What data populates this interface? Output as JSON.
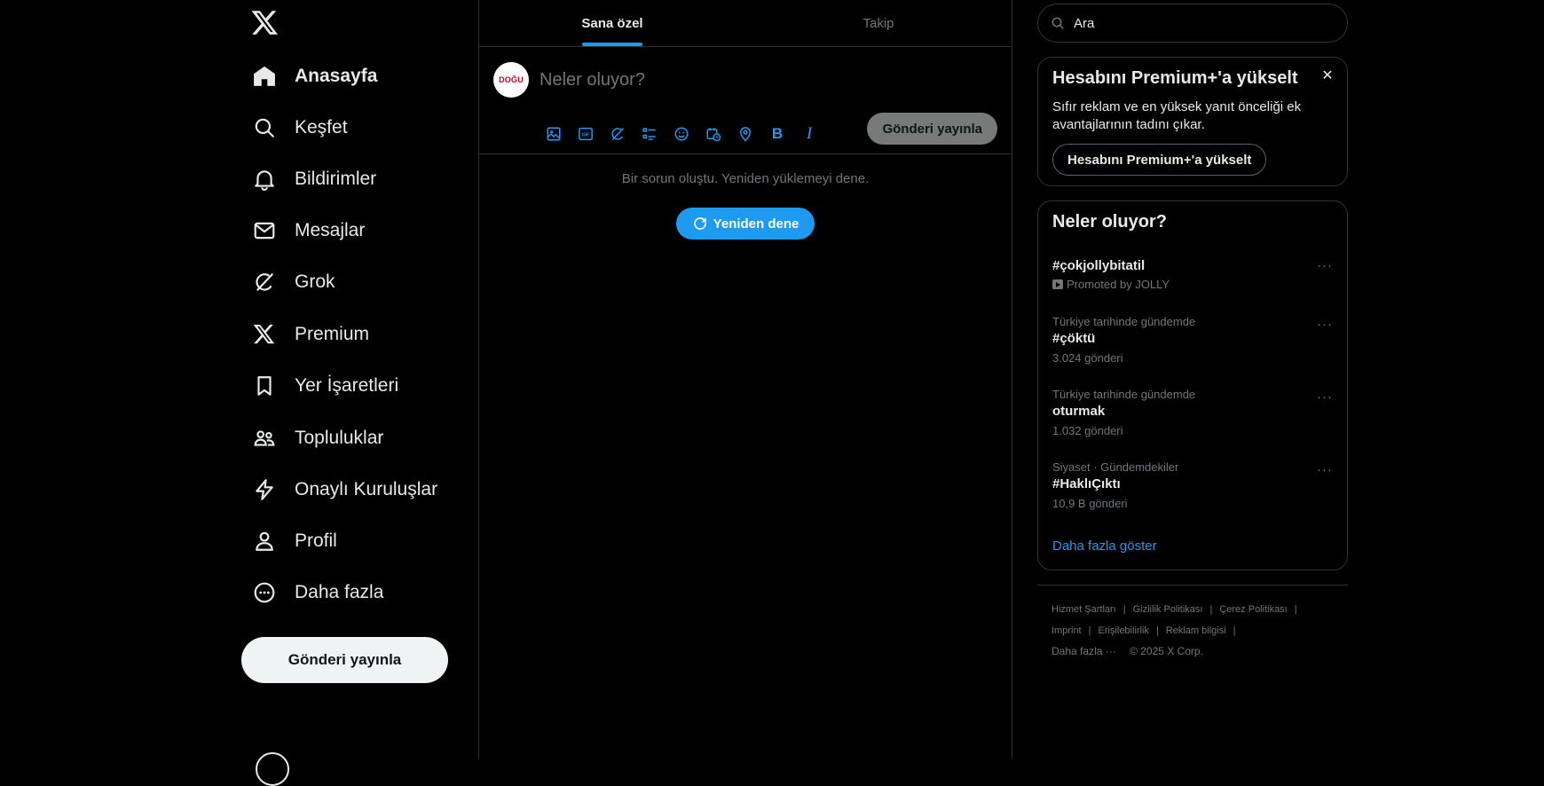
{
  "nav": {
    "items": [
      {
        "label": "Anasayfa",
        "icon": "home-icon",
        "active": true
      },
      {
        "label": "Keşfet",
        "icon": "search-icon"
      },
      {
        "label": "Bildirimler",
        "icon": "bell-icon"
      },
      {
        "label": "Mesajlar",
        "icon": "mail-icon"
      },
      {
        "label": "Grok",
        "icon": "grok-icon"
      },
      {
        "label": "Premium",
        "icon": "x-logo-icon"
      },
      {
        "label": "Yer İşaretleri",
        "icon": "bookmark-icon"
      },
      {
        "label": "Topluluklar",
        "icon": "communities-icon"
      },
      {
        "label": "Onaylı Kuruluşlar",
        "icon": "lightning-icon"
      },
      {
        "label": "Profil",
        "icon": "person-icon"
      },
      {
        "label": "Daha fazla",
        "icon": "more-circle-icon"
      }
    ],
    "post_button": "Gönderi yayınla"
  },
  "timeline": {
    "tabs": [
      {
        "label": "Sana özel",
        "active": true
      },
      {
        "label": "Takip",
        "active": false
      }
    ],
    "composer": {
      "avatar_text": "DOĞU",
      "placeholder": "Neler oluyor?",
      "tools": [
        "image-icon",
        "gif-icon",
        "grok-icon",
        "poll-icon",
        "emoji-icon",
        "schedule-icon",
        "location-icon",
        "bold-icon",
        "italic-icon"
      ],
      "bold_glyph": "B",
      "italic_glyph": "I",
      "submit": "Gönderi yayınla"
    },
    "error": "Bir sorun oluştu. Yeniden yüklemeyi dene.",
    "retry": "Yeniden dene"
  },
  "right": {
    "search_placeholder": "Ara",
    "premium": {
      "title": "Hesabını Premium+'a yükselt",
      "description": "Sıfır reklam ve en yüksek yanıt önceliği ek avantajlarının tadını çıkar.",
      "button": "Hesabını Premium+'a yükselt",
      "close_glyph": "✕"
    },
    "trends": {
      "title": "Neler oluyor?",
      "items": [
        {
          "name": "#çokjollybitatil",
          "promoted": "Promoted by JOLLY"
        },
        {
          "context": "Türkiye tarihinde gündemde",
          "name": "#çöktü",
          "count": "3.024 gönderi"
        },
        {
          "context": "Türkiye tarihinde gündemde",
          "name": "oturmak",
          "count": "1.032 gönderi"
        },
        {
          "context": "Siyaset · Gündemdekiler",
          "name": "#HaklıÇıktı",
          "count": "10,9 B gönderi"
        }
      ],
      "more_glyph": "···",
      "show_more": "Daha fazla göster"
    },
    "footer": {
      "links_row1": [
        "Hizmet Şartları",
        "Gizlilik Politikası",
        "Çerez Politikası"
      ],
      "links_row2": [
        "Imprint",
        "Erişilebilirlik",
        "Reklam bilgisi"
      ],
      "more": "Daha fazla ···",
      "copyright": "© 2025 X Corp."
    }
  },
  "colors": {
    "accent": "#1d9bf0",
    "background": "#000000",
    "text": "#e7e9ea",
    "muted": "#71767b",
    "border": "#2f3336"
  }
}
